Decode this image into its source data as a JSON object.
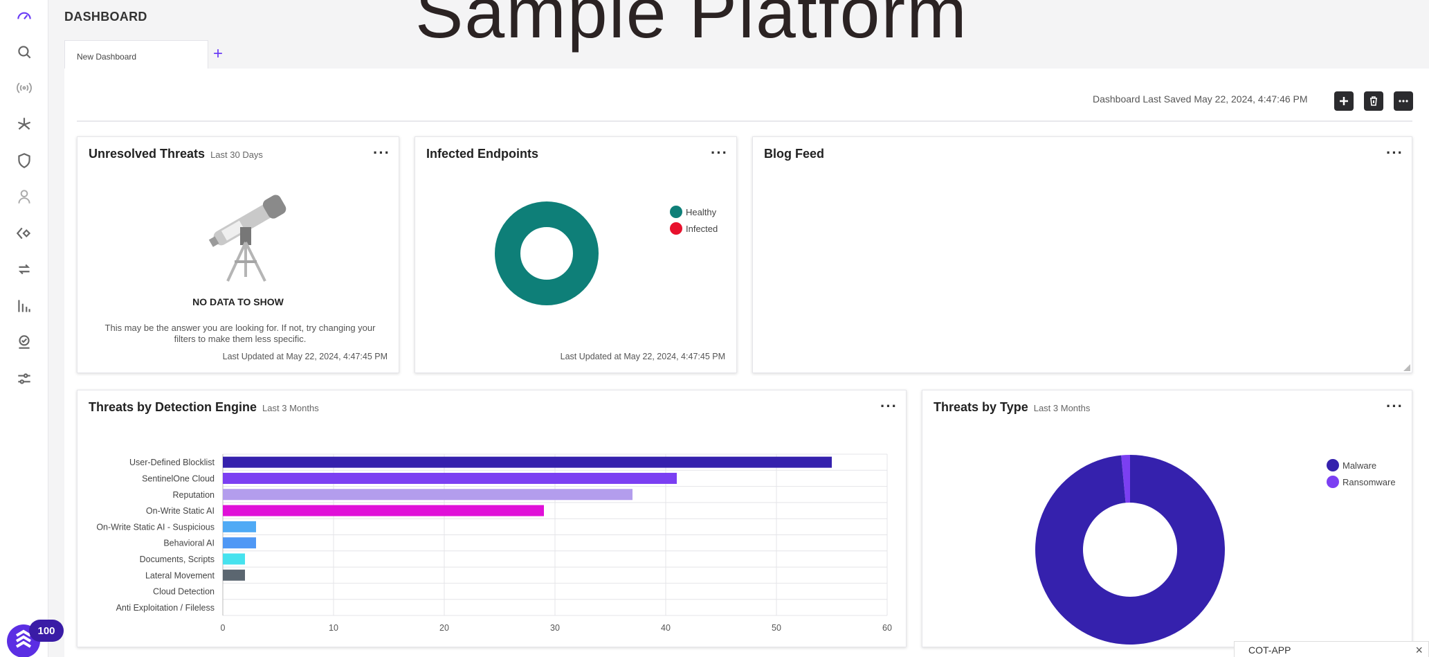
{
  "overlay_title": "Sample Platform",
  "header": {
    "title": "DASHBOARD"
  },
  "tabs": [
    {
      "label": "New Dashboard"
    }
  ],
  "toolbar": {
    "saved_text": "Dashboard Last Saved May 22, 2024, 4:47:46 PM"
  },
  "sidebar": {
    "icons": [
      "gauge-icon",
      "search-icon",
      "broadcast-icon",
      "sparkle-icon",
      "shield-icon",
      "user-icon",
      "diamond-arrow-icon",
      "sync-icon",
      "bar-chart-icon",
      "badge-icon",
      "sliders-icon"
    ],
    "badge": "100"
  },
  "cards": {
    "unresolved": {
      "title": "Unresolved Threats",
      "subtitle": "Last 30 Days",
      "menu": "···",
      "no_data_title": "NO DATA TO SHOW",
      "no_data_body": "This may be the answer you are looking for. If not, try changing your filters to make them less specific.",
      "updated": "Last Updated at May 22, 2024, 4:47:45 PM"
    },
    "infected": {
      "title": "Infected Endpoints",
      "menu": "···",
      "updated": "Last Updated at May 22, 2024, 4:47:45 PM",
      "legend": [
        {
          "label": "Healthy",
          "color": "#0e7f78"
        },
        {
          "label": "Infected",
          "color": "#e8112d"
        }
      ]
    },
    "blog": {
      "title": "Blog Feed",
      "menu": "···"
    },
    "engine": {
      "title": "Threats by Detection Engine",
      "subtitle": "Last 3 Months",
      "menu": "···"
    },
    "type": {
      "title": "Threats by Type",
      "subtitle": "Last 3 Months",
      "menu": "···",
      "legend": [
        {
          "label": "Malware",
          "color": "#3521ad"
        },
        {
          "label": "Ransomware",
          "color": "#7b3ff2"
        }
      ]
    }
  },
  "chart_data": [
    {
      "type": "pie",
      "categories": [
        "Healthy",
        "Infected"
      ],
      "values": [
        100,
        0
      ],
      "colors": [
        "#0e7f78",
        "#e8112d"
      ],
      "donut": true,
      "legend": "right"
    },
    {
      "type": "bar",
      "orientation": "horizontal",
      "categories": [
        "User-Defined Blocklist",
        "SentinelOne Cloud",
        "Reputation",
        "On-Write Static AI",
        "On-Write Static AI - Suspicious",
        "Behavioral AI",
        "Documents, Scripts",
        "Lateral Movement",
        "Cloud Detection",
        "Anti Exploitation / Fileless"
      ],
      "values": [
        55,
        41,
        37,
        29,
        3,
        3,
        2,
        2,
        0,
        0
      ],
      "colors": [
        "#3521ad",
        "#7b3ff2",
        "#b39ded",
        "#e010d8",
        "#4faaf5",
        "#4f98f5",
        "#46e2ee",
        "#5b6670",
        "#cccccc",
        "#cccccc"
      ],
      "xlim": [
        0,
        60
      ],
      "xticks": [
        "0",
        "10",
        "20",
        "30",
        "40",
        "50",
        "60"
      ],
      "grid": true
    },
    {
      "type": "pie",
      "categories": [
        "Malware",
        "Ransomware"
      ],
      "values": [
        98.5,
        1.5
      ],
      "colors": [
        "#3521ad",
        "#7b3ff2"
      ],
      "donut": true,
      "legend": "top-right"
    }
  ],
  "footer": {
    "cot_app": "COT-APP",
    "close": "×"
  }
}
